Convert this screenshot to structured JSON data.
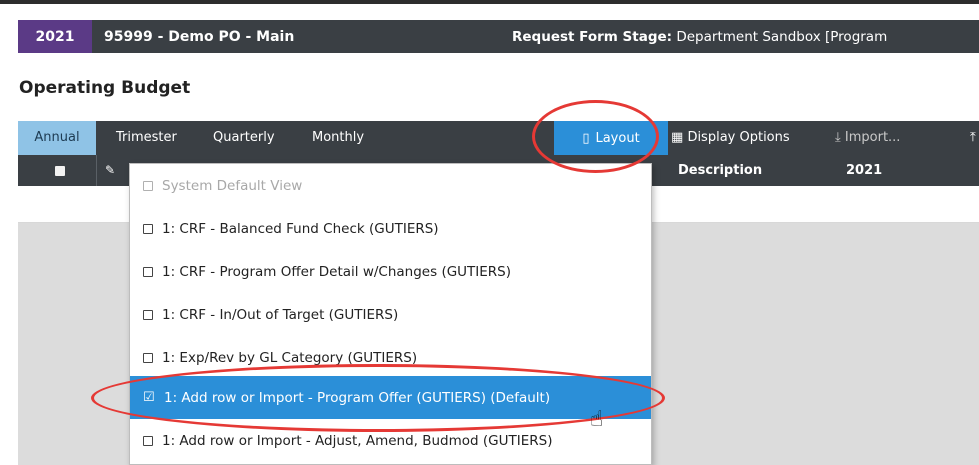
{
  "header": {
    "year": "2021",
    "po_title": "95999 - Demo PO - Main",
    "stage_label": "Request Form Stage:",
    "stage_value": "Department Sandbox [Program"
  },
  "page_title": "Operating Budget",
  "tabs": [
    {
      "label": "Annual",
      "active": true
    },
    {
      "label": "Trimester"
    },
    {
      "label": "Quarterly"
    },
    {
      "label": "Monthly"
    }
  ],
  "toolbar": {
    "layout_icon": "▯",
    "layout_label": "Layout",
    "display_options_icon": "▦",
    "display_options_label": "Display Options",
    "import_icon": "⤓",
    "import_label": "Import...",
    "upload_icon": "⤒"
  },
  "grid": {
    "columns": [
      "Description",
      "2021"
    ]
  },
  "layout_menu": {
    "items": [
      {
        "label": "System Default View",
        "disabled": true
      },
      {
        "label": "1: CRF - Balanced Fund Check (GUTIERS)"
      },
      {
        "label": "1: CRF - Program Offer Detail w/Changes (GUTIERS)"
      },
      {
        "label": "1: CRF - In/Out of Target (GUTIERS)"
      },
      {
        "label": "1: Exp/Rev by GL Category (GUTIERS)"
      },
      {
        "label": "1: Add row or Import - Program Offer (GUTIERS) (Default)",
        "selected": true
      },
      {
        "label": "1: Add row or Import - Adjust, Amend, Budmod (GUTIERS)"
      }
    ]
  },
  "colors": {
    "dark_bar": "#3a3f44",
    "year_badge": "#5b3a86",
    "accent_blue": "#2b8fd8",
    "active_tab": "#8fc3e6",
    "annotation_red": "#e53935"
  }
}
